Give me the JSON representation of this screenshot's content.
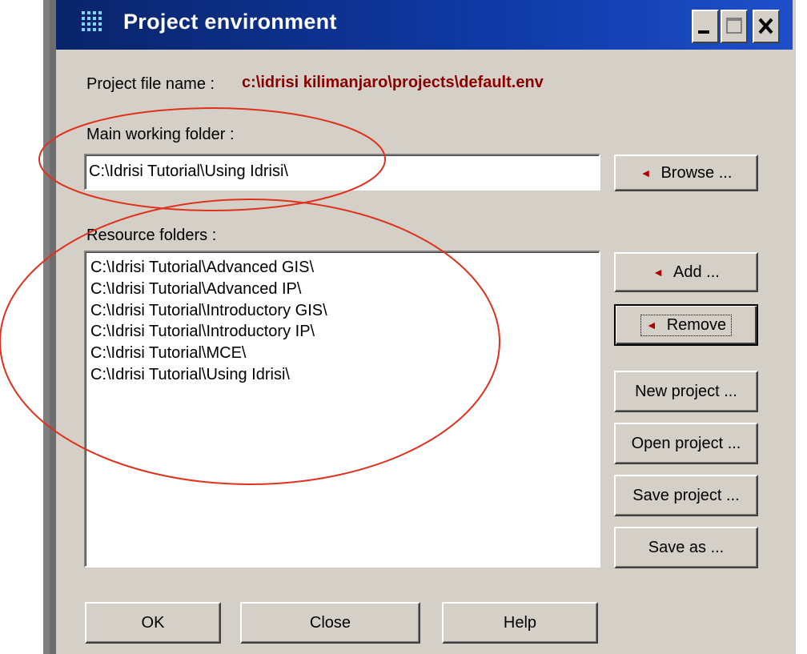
{
  "window": {
    "title": "Project environment"
  },
  "project_file": {
    "label": "Project file name :",
    "value": "c:\\idrisi kilimanjaro\\projects\\default.env"
  },
  "main_folder": {
    "label": "Main working folder :",
    "value": "C:\\Idrisi Tutorial\\Using Idrisi\\",
    "browse_label": "Browse ..."
  },
  "resources": {
    "label": "Resource folders :",
    "items": [
      "C:\\Idrisi Tutorial\\Advanced GIS\\",
      "C:\\Idrisi Tutorial\\Advanced IP\\",
      "C:\\Idrisi Tutorial\\Introductory GIS\\",
      "C:\\Idrisi Tutorial\\Introductory IP\\",
      "C:\\Idrisi Tutorial\\MCE\\",
      "C:\\Idrisi Tutorial\\Using Idrisi\\"
    ],
    "add_label": "Add ...",
    "remove_label": "Remove"
  },
  "project_buttons": {
    "new": "New project ...",
    "open": "Open project ...",
    "save": "Save project ...",
    "save_as": "Save as ..."
  },
  "footer": {
    "ok": "OK",
    "close": "Close",
    "help": "Help"
  },
  "colors": {
    "titlebar": "#0a246a",
    "dialog_bg": "#d4d0c8",
    "path_text": "#8b0000",
    "annotation": "#e0301e"
  },
  "icons": {
    "app": "dot-grid-icon",
    "add_arrow": "triangle-left-icon",
    "remove_arrow": "triangle-left-icon",
    "browse_arrow": "triangle-left-icon"
  }
}
